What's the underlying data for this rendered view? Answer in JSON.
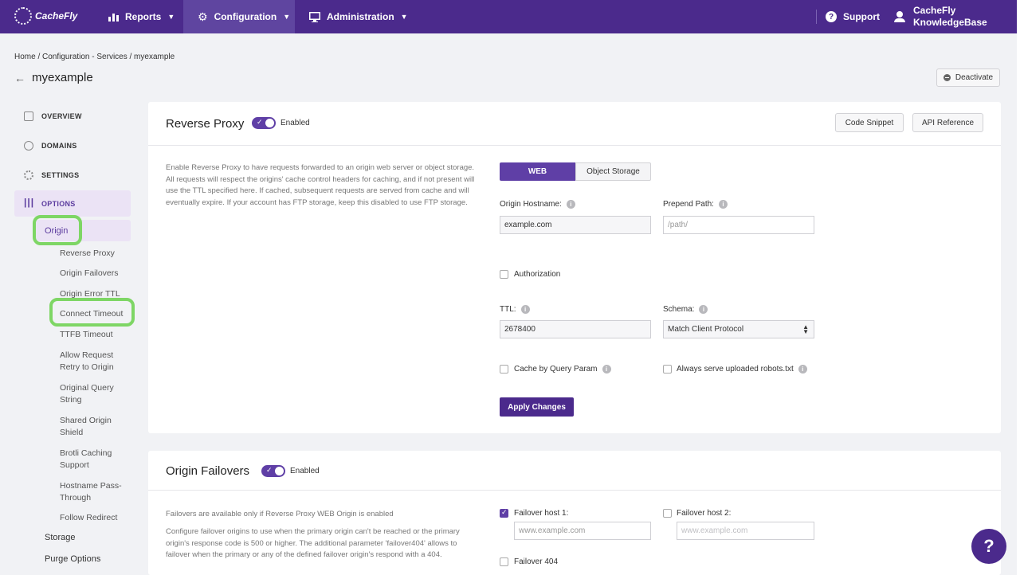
{
  "topnav": {
    "logo": "CacheFly",
    "items": [
      {
        "label": "Reports",
        "icon": "bar-chart-icon"
      },
      {
        "label": "Configuration",
        "icon": "gear-icon"
      },
      {
        "label": "Administration",
        "icon": "monitor-icon"
      }
    ],
    "support": "Support",
    "user_line1": "CacheFly",
    "user_line2": "KnowledgeBase"
  },
  "breadcrumb": "Home / Configuration - Services / myexample",
  "page_title": "myexample",
  "deactivate_label": "Deactivate",
  "sidebar": {
    "main": [
      "OVERVIEW",
      "DOMAINS",
      "SETTINGS",
      "OPTIONS"
    ],
    "origin": "Origin",
    "sub": [
      "Reverse Proxy",
      "Origin Failovers",
      "Origin Error TTL",
      "Connect Timeout",
      "TTFB Timeout",
      "Allow Request Retry to Origin",
      "Original Query String",
      "Shared Origin Shield",
      "Brotli Caching Support",
      "Hostname Pass-Through",
      "Follow Redirect"
    ],
    "lower": [
      "Storage",
      "Purge Options"
    ]
  },
  "reverse_proxy": {
    "title": "Reverse Proxy",
    "enabled_label": "Enabled",
    "code_snippet": "Code Snippet",
    "api_reference": "API Reference",
    "description": "Enable Reverse Proxy to have requests forwarded to an origin web server or object storage. All requests will respect the origins' cache control headers for caching, and if not present will use the TTL specified here. If cached, subsequent requests are served from cache and will eventually expire. If your account has FTP storage, keep this disabled to use FTP storage.",
    "seg_web": "WEB",
    "seg_object": "Object Storage",
    "origin_hostname_label": "Origin Hostname:",
    "origin_hostname_value": "example.com",
    "prepend_path_label": "Prepend Path:",
    "prepend_path_placeholder": "/path/",
    "authorization_label": "Authorization",
    "ttl_label": "TTL:",
    "ttl_value": "2678400",
    "schema_label": "Schema:",
    "schema_value": "Match Client Protocol",
    "cache_query_label": "Cache by Query Param",
    "robots_label": "Always serve uploaded robots.txt",
    "apply_label": "Apply Changes"
  },
  "origin_failovers": {
    "title": "Origin Failovers",
    "enabled_label": "Enabled",
    "desc1": "Failovers are available only if Reverse Proxy WEB Origin is enabled",
    "desc2": "Configure failover origins to use when the primary origin can't be reached or the primary origin's response code is 500 or higher. The additional parameter 'failover404' allows to failover when the primary or any of the defined failover origin's respond with a 404.",
    "host1_label": "Failover host 1:",
    "host1_placeholder": "www.example.com",
    "host2_label": "Failover host 2:",
    "host2_placeholder": "www.example.com",
    "failover404_label": "Failover 404"
  },
  "help_fab": "?",
  "colors": {
    "brand": "#4b2a8c",
    "accent": "#5f3fa6",
    "highlight": "#7ed665"
  }
}
